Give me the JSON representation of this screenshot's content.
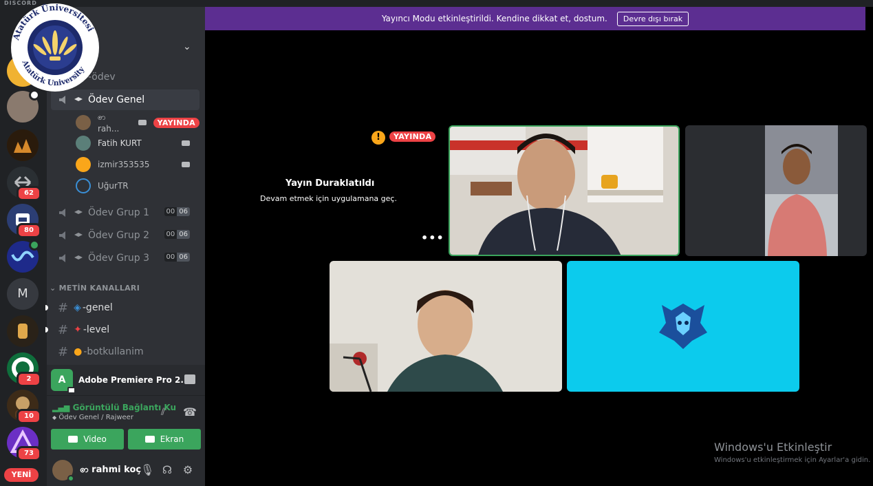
{
  "app": {
    "label": "DISCORD"
  },
  "logo": {
    "text_top": "Atatürk Üniversitesi",
    "text_bottom": "Atatürk University",
    "year": "1957"
  },
  "rail": {
    "servers": [
      {
        "badge": ""
      },
      {
        "badge": ""
      },
      {
        "badge": ""
      },
      {
        "badge": "62"
      },
      {
        "badge": "80"
      },
      {
        "badge": ""
      },
      {
        "letter": "M",
        "badge": ""
      },
      {
        "badge": ""
      },
      {
        "badge": "2"
      },
      {
        "badge": "10"
      },
      {
        "badge": "73"
      }
    ],
    "new_label": "YENİ"
  },
  "sidebar": {
    "category": "-ödev",
    "voice_channels": [
      {
        "name": "Ödev Genel",
        "count_a": "",
        "count_b": ""
      },
      {
        "name": "Ödev Grup 1",
        "count_a": "00",
        "count_b": "06"
      },
      {
        "name": "Ödev Grup 2",
        "count_a": "00",
        "count_b": "06"
      },
      {
        "name": "Ödev Grup 3",
        "count_a": "00",
        "count_b": "06"
      }
    ],
    "members": [
      {
        "name": "ꩦ rah...",
        "badge": "YAYINDA"
      },
      {
        "name": "Fatih KURT"
      },
      {
        "name": "izmir353535"
      },
      {
        "name": "UğurTR"
      }
    ],
    "text_category": "METİN KANALLARI",
    "text_channels": [
      {
        "name": "-genel"
      },
      {
        "name": "-level"
      },
      {
        "name": "-botkullanim"
      }
    ]
  },
  "activity": {
    "icon_letter": "A",
    "title": "Adobe Premiere Pro 2..."
  },
  "voice_panel": {
    "status": "Görüntülü Bağlantı Ku",
    "location": "Ödev Genel / Rajweer",
    "video_label": "Video",
    "screen_label": "Ekran"
  },
  "user": {
    "name": "ꩦ rahmi koç"
  },
  "banner": {
    "message": "Yayıncı Modu etkinleştirildi. Kendine dikkat et, dostum.",
    "button": "Devre dışı bırak"
  },
  "stage": {
    "live_badge": "YAYINDA",
    "paused_title": "Yayın Duraklatıldı",
    "paused_sub": "Devam etmek için uygulamana geç.",
    "more": "•••"
  },
  "watermark": {
    "title": "Windows'u Etkinleştir",
    "sub": "Windows'u etkinleştirmek için Ayarlar'a gidin."
  },
  "colors": {
    "rail": "#202225",
    "sidebar": "#2f3136",
    "banner": "#5c2e91",
    "green": "#3ba55d",
    "live": "#ed4245",
    "tile_cyan": "#0ccbed"
  }
}
